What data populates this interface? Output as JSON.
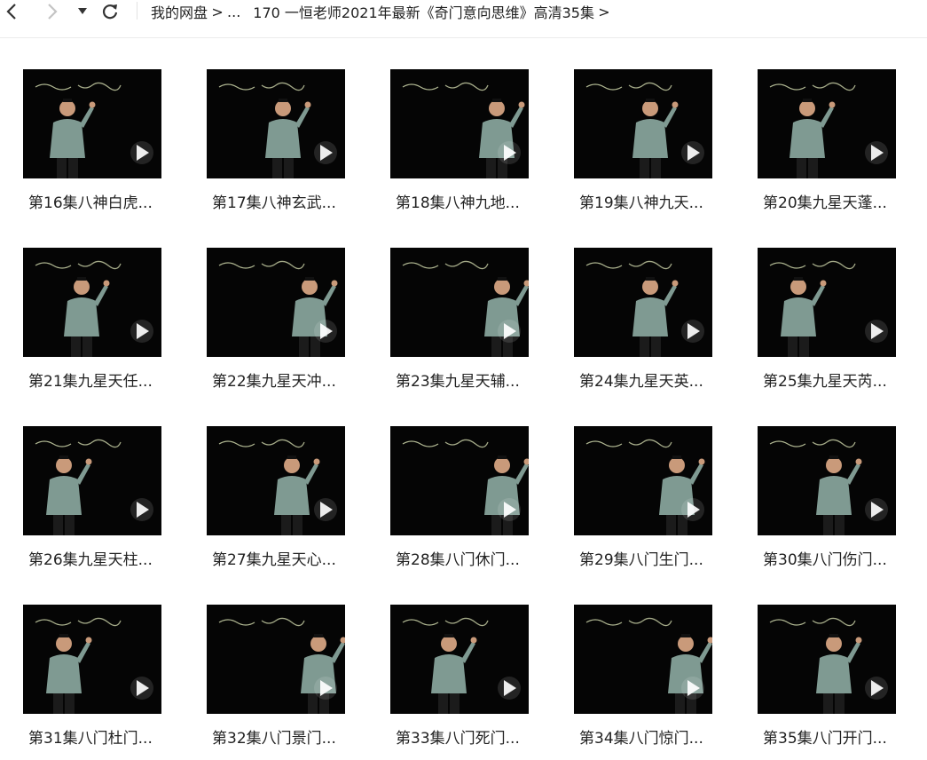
{
  "toolbar": {
    "back_icon": "chevron-left-icon",
    "forward_icon": "chevron-right-icon",
    "history_icon": "caret-down-icon",
    "refresh_icon": "refresh-icon"
  },
  "breadcrumb": {
    "root": "我的网盘",
    "ellipsis": "...",
    "current": "170 一恒老师2021年最新《奇门意向思维》高清35集",
    "separator": ">"
  },
  "videos": [
    {
      "title": "第16集八神白虎..."
    },
    {
      "title": "第17集八神玄武..."
    },
    {
      "title": "第18集八神九地..."
    },
    {
      "title": "第19集八神九天..."
    },
    {
      "title": "第20集九星天蓬..."
    },
    {
      "title": "第21集九星天任..."
    },
    {
      "title": "第22集九星天冲..."
    },
    {
      "title": "第23集九星天辅..."
    },
    {
      "title": "第24集九星天英..."
    },
    {
      "title": "第25集九星天芮..."
    },
    {
      "title": "第26集九星天柱..."
    },
    {
      "title": "第27集九星天心..."
    },
    {
      "title": "第28集八门休门..."
    },
    {
      "title": "第29集八门生门..."
    },
    {
      "title": "第30集八门伤门..."
    },
    {
      "title": "第31集八门杜门..."
    },
    {
      "title": "第32集八门景门..."
    },
    {
      "title": "第33集八门死门..."
    },
    {
      "title": "第34集八门惊门..."
    },
    {
      "title": "第35集八门开门..."
    }
  ],
  "colors": {
    "thumb_bg": "#050505",
    "person_top": "#7f9a92",
    "chalk": "#d9e2b4"
  }
}
